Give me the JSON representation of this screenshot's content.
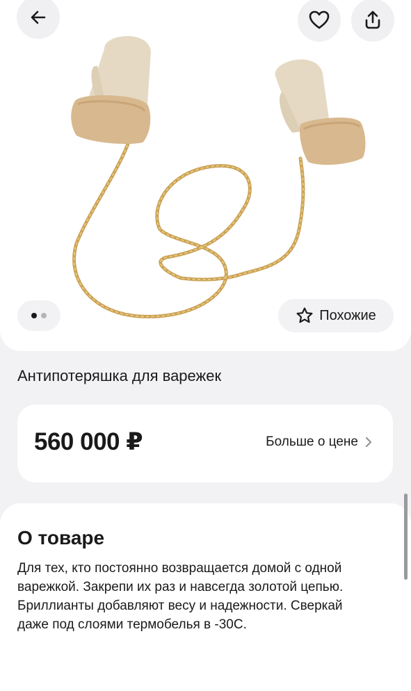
{
  "header": {
    "back_icon": "arrow-left-icon",
    "favorite_icon": "heart-icon",
    "share_icon": "share-icon"
  },
  "gallery": {
    "image_description": "",
    "total_images": 2,
    "current_image": 1,
    "similar_label": "Похожие",
    "similar_icon": "star-icon"
  },
  "product": {
    "title": "Антипотеряшка для варежек"
  },
  "price": {
    "value": "560 000 ₽",
    "more_label": "Больше о цене",
    "more_icon": "chevron-right-icon"
  },
  "about": {
    "title": "О товаре",
    "description": "Для тех, кто постоянно возвращается домой с одной варежкой. Закрепи их раз и навсегда золотой цепью. Бриллианты добавляют весу и надежности. Сверкай даже под слоями термобелья в -30С."
  },
  "colors": {
    "background": "#f2f2f4",
    "card": "#ffffff",
    "mitten": "#e6d9c4",
    "fur": "#d8b88e",
    "chain": "#c9a054"
  }
}
